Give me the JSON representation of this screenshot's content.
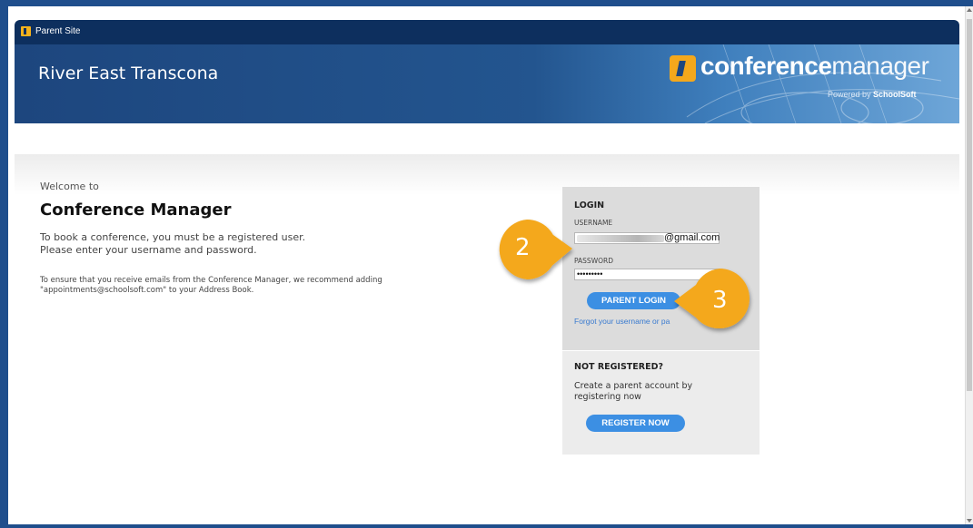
{
  "window": {
    "title": "Parent Site"
  },
  "banner": {
    "school_name": "River East Transcona",
    "logo_bold": "conference",
    "logo_light": "manager",
    "powered_prefix": "Powered by",
    "powered_brand": "SchoolSoft"
  },
  "main": {
    "welcome": "Welcome to",
    "heading": "Conference Manager",
    "intro_line1": "To book a conference, you must be a registered user.",
    "intro_line2": "Please enter your username and password.",
    "note_line1": "To ensure that you receive emails from the Conference Manager, we recommend adding",
    "note_line2": "\"appointments@schoolsoft.com\" to your Address Book."
  },
  "login": {
    "title": "LOGIN",
    "username_label": "USERNAME",
    "username_suffix": "@gmail.com",
    "password_label": "PASSWORD",
    "password_value": "•••••••••",
    "login_button": "PARENT LOGIN",
    "forgot_link": "Forgot your username or pa"
  },
  "register": {
    "title": "NOT REGISTERED?",
    "text_line1": "Create a parent account by",
    "text_line2": "registering now",
    "button": "REGISTER NOW"
  },
  "callouts": {
    "step_2": "2",
    "step_3": "3"
  },
  "colors": {
    "frame": "#1f4e8c",
    "titlebar": "#0d2f5e",
    "accent_button": "#3c8fe3",
    "callout": "#f4a81c",
    "link": "#3a7bd0"
  }
}
